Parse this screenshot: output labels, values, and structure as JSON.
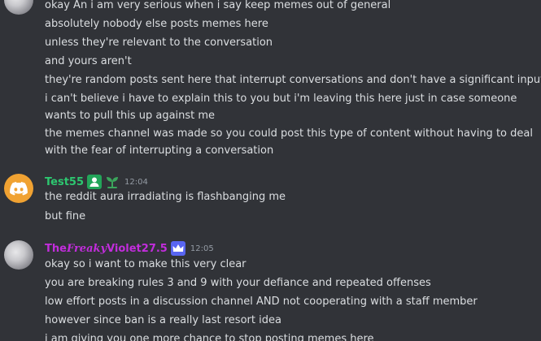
{
  "messages_top": {
    "lines": [
      "okay An i am very serious when i say keep memes out of general",
      "absolutely nobody else posts memes here",
      "unless they're relevant to the conversation",
      "and yours aren't",
      "they're random posts sent here that interrupt conversations and don't have a significant input",
      "i can't believe i have to explain this to you but i'm leaving this here just in case someone wants to pull this up against me",
      "the memes channel was made so you could post this type of content without having to deal with the fear of interrupting a conversation"
    ]
  },
  "test55": {
    "username": "Test55",
    "timestamp": "12:04",
    "lines": [
      "the reddit aura irradiating is flashbanging me",
      "but fine"
    ]
  },
  "violet": {
    "username_prefix": "The",
    "username_fancy": "Freaky",
    "username_suffix": "Violet27.5",
    "timestamp": "12:05",
    "lines": [
      "okay so i want to make this very clear",
      "you are breaking rules 3 and 9 with your defiance and repeated offenses",
      "low effort posts in a discussion channel AND not cooperating with a staff member",
      "however since ban is a really last resort idea",
      "i am giving you one more chance to stop posting memes here"
    ]
  },
  "colors": {
    "background": "#313338",
    "text": "#dbdee1",
    "timestamp": "#949ba4",
    "test55_name": "#2dc770",
    "violet_name": "#c22ddc",
    "discord_avatar": "#f0a232"
  }
}
